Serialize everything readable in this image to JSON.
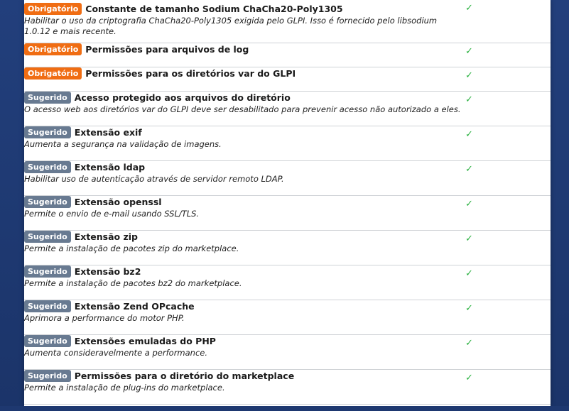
{
  "colors": {
    "required_badge": "#f06d13",
    "suggested_badge": "#687a91",
    "check": "#2fb344",
    "background": "#1f3a73"
  },
  "checks": [
    {
      "badge": "Obrigatório",
      "badge_type": "required",
      "title": "Constante de tamanho Sodium ChaCha20-Poly1305",
      "description": "Habilitar o uso da criptografia ChaCha20-Poly1305 exigida pelo GLPI. Isso é fornecido pelo libsodium 1.0.12 e mais recente.",
      "status": "✓"
    },
    {
      "badge": "Obrigatório",
      "badge_type": "required",
      "title": "Permissões para arquivos de log",
      "description": "",
      "status": "✓"
    },
    {
      "badge": "Obrigatório",
      "badge_type": "required",
      "title": "Permissões para os diretórios var do GLPI",
      "description": "",
      "status": "✓"
    },
    {
      "badge": "Sugerido",
      "badge_type": "suggested",
      "title": "Acesso protegido aos arquivos do diretório",
      "description": "O acesso web aos diretórios var do GLPI deve ser desabilitado para prevenir acesso não autorizado a eles.",
      "status": "✓"
    },
    {
      "badge": "Sugerido",
      "badge_type": "suggested",
      "title": "Extensão exif",
      "description": "Aumenta a segurança na validação de imagens.",
      "status": "✓"
    },
    {
      "badge": "Sugerido",
      "badge_type": "suggested",
      "title": "Extensão ldap",
      "description": "Habilitar uso de autenticação através de servidor remoto LDAP.",
      "status": "✓"
    },
    {
      "badge": "Sugerido",
      "badge_type": "suggested",
      "title": "Extensão openssl",
      "description": "Permite o envio de e-mail usando SSL/TLS.",
      "status": "✓"
    },
    {
      "badge": "Sugerido",
      "badge_type": "suggested",
      "title": "Extensão zip",
      "description": "Permite a instalação de pacotes zip do marketplace.",
      "status": "✓"
    },
    {
      "badge": "Sugerido",
      "badge_type": "suggested",
      "title": "Extensão bz2",
      "description": "Permite a instalação de pacotes bz2 do marketplace.",
      "status": "✓"
    },
    {
      "badge": "Sugerido",
      "badge_type": "suggested",
      "title": "Extensão Zend OPcache",
      "description": "Aprimora a performance do motor PHP.",
      "status": "✓"
    },
    {
      "badge": "Sugerido",
      "badge_type": "suggested",
      "title": "Extensões emuladas do PHP",
      "description": "Aumenta consideravelmente a performance.",
      "status": "✓"
    },
    {
      "badge": "Sugerido",
      "badge_type": "suggested",
      "title": "Permissões para o diretório do marketplace",
      "description": "Permite a instalação de plug-ins do marketplace.",
      "status": "✓"
    }
  ]
}
